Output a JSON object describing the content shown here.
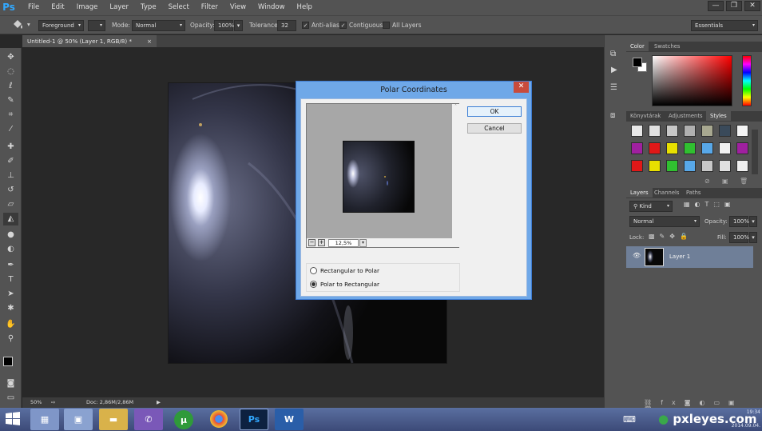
{
  "app": {
    "logo": "Ps"
  },
  "menu": [
    "File",
    "Edit",
    "Image",
    "Layer",
    "Type",
    "Select",
    "Filter",
    "View",
    "Window",
    "Help"
  ],
  "window_controls": [
    "—",
    "❐",
    "✕"
  ],
  "options_bar": {
    "fill_source": "Foreground",
    "mode_label": "Mode:",
    "mode_value": "Normal",
    "opacity_label": "Opacity:",
    "opacity_value": "100%",
    "tolerance_label": "Tolerance:",
    "tolerance_value": "32",
    "anti_alias_label": "Anti-alias",
    "contiguous_label": "Contiguous",
    "all_layers_label": "All Layers",
    "workspace": "Essentials"
  },
  "document": {
    "tab_title": "Untitled-1 @ 50% (Layer 1, RGB/8) *",
    "tab_close": "×",
    "zoom": "50%",
    "doc_info": "Doc: 2,86M/2,86M"
  },
  "color_panel": {
    "tabs": [
      "Color",
      "Swatches"
    ]
  },
  "styles_panel": {
    "tabs": [
      "Könyvtárak",
      "Adjustments",
      "Styles"
    ],
    "colors": [
      "#e8e8e8",
      "#e0e0e0",
      "#c8c8c8",
      "#b0b0b0",
      "#a8a890",
      "#3a4a5a",
      "#f4f4f4",
      "#a020a0",
      "#e01818",
      "#e8e000",
      "#30c030",
      "#58a8e8",
      "#f0f0f0",
      "#a020a0",
      "#e01818",
      "#e8e000",
      "#30c030",
      "#58a8e8",
      "#c8c8c8",
      "#e0e0e0",
      "#f0f0f0"
    ]
  },
  "layers_panel": {
    "tabs": [
      "Layers",
      "Channels",
      "Paths"
    ],
    "filter_label": "Kind",
    "blend_mode": "Normal",
    "opacity_label": "Opacity:",
    "opacity_value": "100%",
    "lock_label": "Lock:",
    "fill_label": "Fill:",
    "fill_value": "100%",
    "layer_name": "Layer 1"
  },
  "dialog": {
    "title": "Polar Coordinates",
    "ok": "OK",
    "cancel": "Cancel",
    "zoom": "12,5%",
    "option1": "Rectangular to Polar",
    "option2": "Polar to Rectangular",
    "selected_option": "Polar to Rectangular"
  },
  "taskbar": {
    "time": "19:34",
    "date": "2014.09.04.",
    "watermark": "pxleyes.com"
  }
}
